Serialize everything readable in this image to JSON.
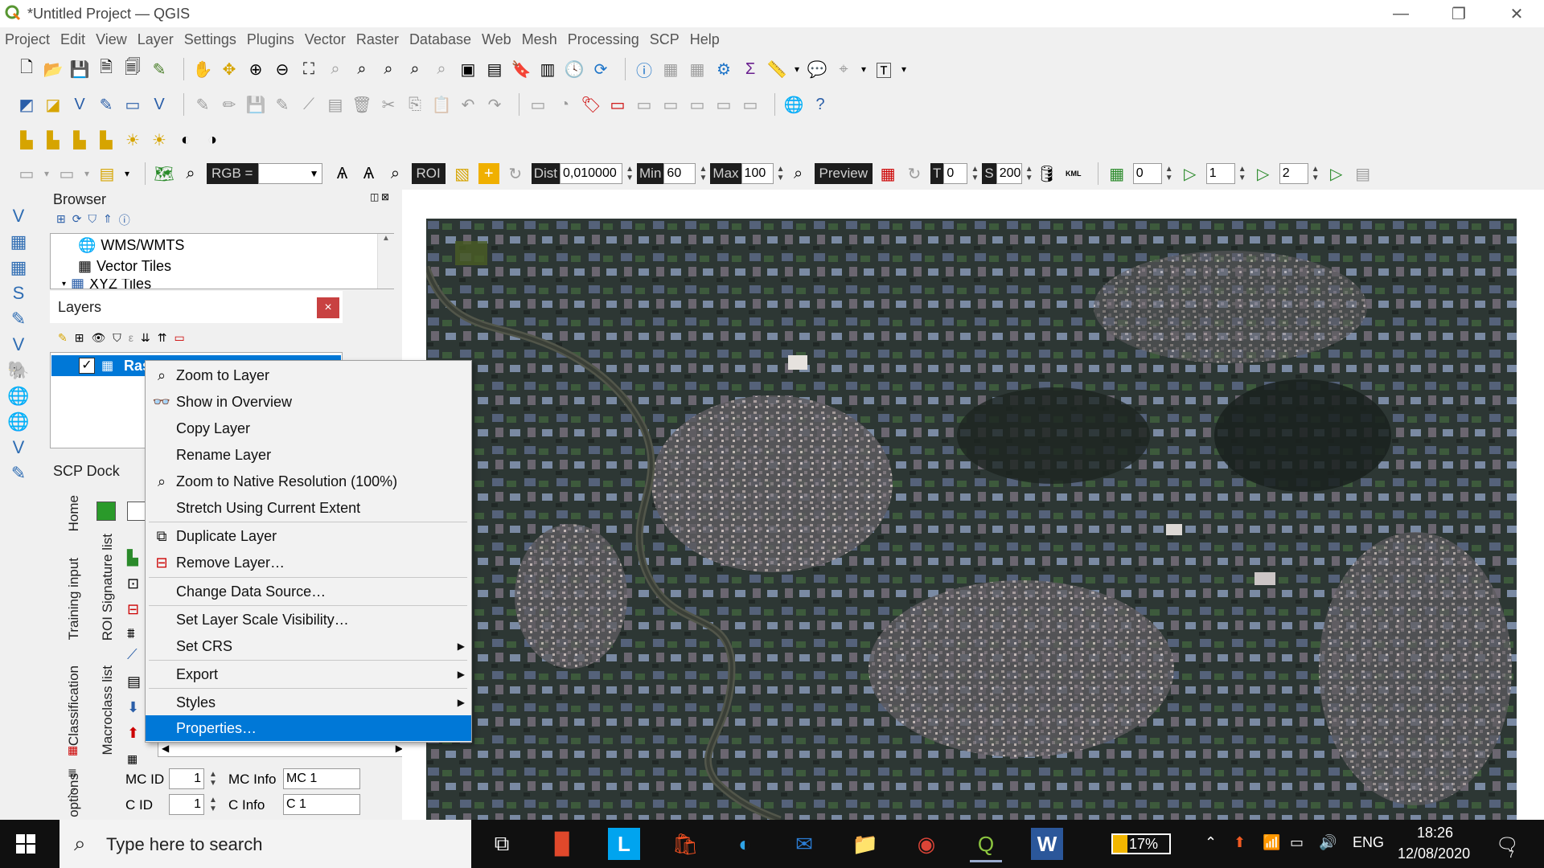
{
  "window": {
    "title": "*Untitled Project — QGIS",
    "minimize_icon": "minimize-icon",
    "restore_icon": "restore-icon",
    "close_icon": "close-icon"
  },
  "menu": [
    "Project",
    "Edit",
    "View",
    "Layer",
    "Settings",
    "Plugins",
    "Vector",
    "Raster",
    "Database",
    "Web",
    "Mesh",
    "Processing",
    "SCP",
    "Help"
  ],
  "scp_toolbar": {
    "rgb_label": "RGB =",
    "rgb_value": "",
    "roi_label": "ROI",
    "dist_label": "Dist",
    "dist_value": "0,010000",
    "min_label": "Min",
    "min_value": "60",
    "max_label": "Max",
    "max_value": "100",
    "preview_label": "Preview",
    "t_label": "T",
    "t_value": "0",
    "s_label": "S",
    "s_value": "200",
    "kml_label": "KML",
    "band1_value": "0",
    "band2_value": "1",
    "band3_value": "2"
  },
  "browser": {
    "title": "Browser",
    "items": [
      {
        "label": "WMS/WMTS",
        "icon": "globe-icon"
      },
      {
        "label": "Vector Tiles",
        "icon": "grid-icon"
      },
      {
        "label": "XYZ Tiles",
        "icon": "grid-icon"
      }
    ]
  },
  "layers": {
    "title": "Layers",
    "layer_name": "Ras"
  },
  "context_menu": [
    {
      "label": "Zoom to Layer",
      "icon": "zoom-icon"
    },
    {
      "label": "Show in Overview",
      "icon": "overview-icon"
    },
    {
      "label": "Copy Layer",
      "icon": ""
    },
    {
      "label": "Rename Layer",
      "icon": ""
    },
    {
      "label": "Zoom to Native Resolution (100%)",
      "icon": "zoom-native-icon"
    },
    {
      "label": "Stretch Using Current Extent",
      "icon": ""
    },
    {
      "label": "Duplicate Layer",
      "icon": "duplicate-icon"
    },
    {
      "label": "Remove Layer…",
      "icon": "remove-icon"
    },
    {
      "label": "Change Data Source…",
      "icon": ""
    },
    {
      "label": "Set Layer Scale Visibility…",
      "icon": ""
    },
    {
      "label": "Set CRS",
      "icon": "",
      "submenu": true
    },
    {
      "label": "Export",
      "icon": "",
      "submenu": true
    },
    {
      "label": "Styles",
      "icon": "",
      "submenu": true
    },
    {
      "label": "Properties…",
      "icon": "",
      "selected": true
    }
  ],
  "scp_dock": {
    "title": "SCP Dock",
    "tabs_left": [
      "Home",
      "Training input",
      "Classification",
      "options"
    ],
    "tabs_right": [
      "ROI Signature list",
      "Macroclass list"
    ],
    "mc_id_label": "MC ID",
    "mc_id_value": "1",
    "mc_info_label": "MC Info",
    "mc_info_value": "MC 1",
    "c_id_label": "C ID",
    "c_id_value": "1",
    "c_info_label": "C Info",
    "c_info_value": "C 1"
  },
  "taskbar": {
    "search_placeholder": "Type here to search",
    "battery": "17%",
    "language": "ENG",
    "time": "18:26",
    "date": "12/08/2020",
    "notifications": "7"
  }
}
